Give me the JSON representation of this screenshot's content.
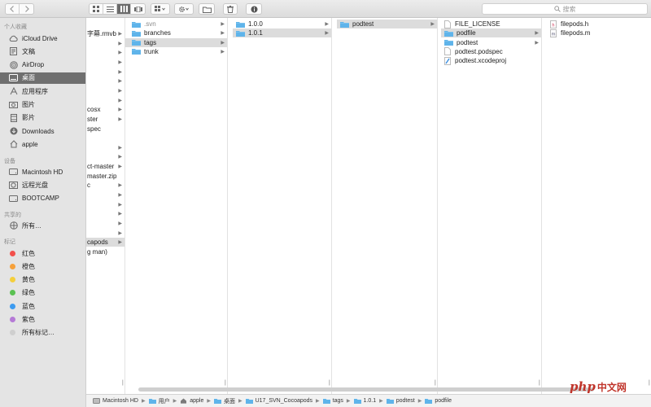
{
  "toolbar": {
    "search_placeholder": "搜索",
    "nav_back_icon": "chevron-left-icon",
    "nav_forward_icon": "chevron-right-icon"
  },
  "sidebar": {
    "sections": {
      "favorites": "个人收藏",
      "devices": "设备",
      "shared": "共享的",
      "tags": "标记"
    },
    "favorites": [
      {
        "label": "iCloud Drive",
        "icon": "cloud-icon"
      },
      {
        "label": "文稿",
        "icon": "document-icon"
      },
      {
        "label": "AirDrop",
        "icon": "airdrop-icon"
      },
      {
        "label": "桌面",
        "icon": "desktop-icon",
        "selected": true
      },
      {
        "label": "应用程序",
        "icon": "applications-icon"
      },
      {
        "label": "图片",
        "icon": "camera-icon"
      },
      {
        "label": "影片",
        "icon": "film-icon"
      },
      {
        "label": "Downloads",
        "icon": "download-icon"
      },
      {
        "label": "apple",
        "icon": "home-icon"
      }
    ],
    "devices": [
      {
        "label": "Macintosh HD",
        "icon": "drive-icon"
      },
      {
        "label": "远程光盘",
        "icon": "disc-icon"
      },
      {
        "label": "BOOTCAMP",
        "icon": "drive-icon"
      }
    ],
    "shared": [
      {
        "label": "所有…",
        "icon": "network-icon"
      }
    ],
    "tags": [
      {
        "label": "红色",
        "color": "#f2504b"
      },
      {
        "label": "橙色",
        "color": "#f6a13b"
      },
      {
        "label": "黄色",
        "color": "#f4cf3c"
      },
      {
        "label": "绿色",
        "color": "#5ac152"
      },
      {
        "label": "蓝色",
        "color": "#3d9bf0"
      },
      {
        "label": "紫色",
        "color": "#b57ad6"
      },
      {
        "label": "所有标记…",
        "color": "#cfcfcf"
      }
    ]
  },
  "columns": {
    "col0": {
      "items": [
        {
          "label": "字幕.rmvb",
          "arrow": true
        },
        {
          "label": "",
          "arrow": true
        },
        {
          "label": "",
          "arrow": true
        },
        {
          "label": "",
          "arrow": true
        },
        {
          "label": "",
          "arrow": true
        },
        {
          "label": "",
          "arrow": true
        },
        {
          "label": "",
          "arrow": true
        },
        {
          "label": "",
          "arrow": true
        },
        {
          "label": "cosx",
          "arrow": true
        },
        {
          "label": "ster",
          "arrow": true
        },
        {
          "label": "spec",
          "arrow": false
        },
        {
          "label": "",
          "arrow": false
        },
        {
          "label": "",
          "arrow": true
        },
        {
          "label": "",
          "arrow": true
        },
        {
          "label": "ct-master",
          "arrow": true
        },
        {
          "label": "master.zip",
          "arrow": false
        },
        {
          "label": "c",
          "arrow": true
        },
        {
          "label": "",
          "arrow": true
        },
        {
          "label": "",
          "arrow": true
        },
        {
          "label": "",
          "arrow": true
        },
        {
          "label": "",
          "arrow": true
        },
        {
          "label": "",
          "arrow": true
        },
        {
          "label": "capods",
          "arrow": true,
          "selected": true
        },
        {
          "label": "g man)",
          "arrow": false
        }
      ]
    },
    "col1": {
      "items": [
        {
          "label": ".svn",
          "arrow": true,
          "faded": true
        },
        {
          "label": "branches",
          "arrow": true
        },
        {
          "label": "tags",
          "arrow": true,
          "selected": true
        },
        {
          "label": "trunk",
          "arrow": true
        }
      ]
    },
    "col2": {
      "items": [
        {
          "label": "1.0.0",
          "arrow": true
        },
        {
          "label": "1.0.1",
          "arrow": true,
          "selected": true
        }
      ]
    },
    "col3": {
      "items": [
        {
          "label": "podtest",
          "arrow": true,
          "selected": true
        }
      ]
    },
    "col4": {
      "items": [
        {
          "label": "FILE_LICENSE",
          "kind": "file",
          "arrow": false
        },
        {
          "label": "podfile",
          "kind": "folder",
          "arrow": true,
          "selected": true
        },
        {
          "label": "podtest",
          "kind": "folder",
          "arrow": true
        },
        {
          "label": "podtest.podspec",
          "kind": "file",
          "arrow": false
        },
        {
          "label": "podtest.xcodeproj",
          "kind": "xcode",
          "arrow": false
        }
      ]
    },
    "col5": {
      "items": [
        {
          "label": "filepods.h",
          "kind": "h"
        },
        {
          "label": "filepods.m",
          "kind": "m"
        }
      ]
    }
  },
  "pathbar": [
    {
      "label": "Macintosh HD",
      "icon": "drive-icon"
    },
    {
      "label": "用户",
      "icon": "folder-icon"
    },
    {
      "label": "apple",
      "icon": "home-icon"
    },
    {
      "label": "桌面",
      "icon": "folder-icon"
    },
    {
      "label": "U17_SVN_Cocoapods",
      "icon": "folder-icon"
    },
    {
      "label": "tags",
      "icon": "folder-icon"
    },
    {
      "label": "1.0.1",
      "icon": "folder-icon"
    },
    {
      "label": "podtest",
      "icon": "folder-icon"
    },
    {
      "label": "podfile",
      "icon": "folder-icon"
    }
  ],
  "watermark": {
    "brand": "php",
    "site": "中文网"
  },
  "colors": {
    "folder": "#5fb4ea",
    "selected_sidebar": "#6f6f6f",
    "selected_row": "#dcdcdc"
  }
}
